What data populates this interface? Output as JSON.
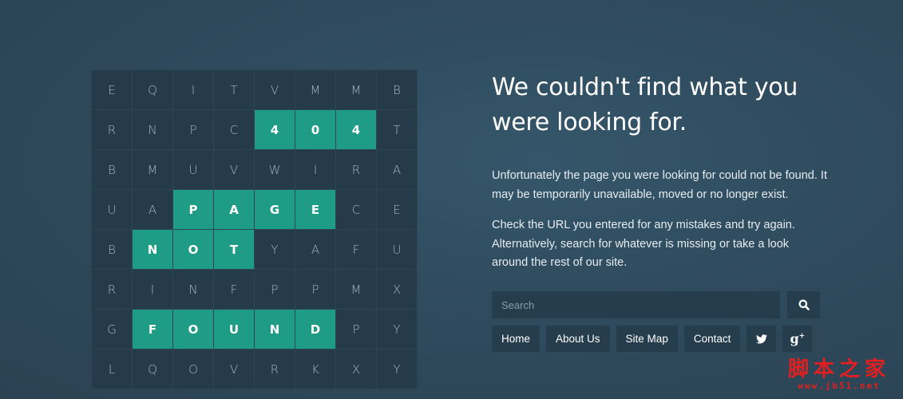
{
  "letter_grid": {
    "rows": [
      [
        "E",
        "Q",
        "I",
        "T",
        "V",
        "M",
        "M",
        "B"
      ],
      [
        "R",
        "N",
        "P",
        "C",
        "4",
        "0",
        "4",
        "T"
      ],
      [
        "B",
        "M",
        "U",
        "V",
        "W",
        "I",
        "R",
        "A"
      ],
      [
        "U",
        "A",
        "P",
        "A",
        "G",
        "E",
        "C",
        "E"
      ],
      [
        "B",
        "N",
        "O",
        "T",
        "Y",
        "A",
        "F",
        "U"
      ],
      [
        "R",
        "I",
        "N",
        "F",
        "P",
        "P",
        "M",
        "X"
      ],
      [
        "G",
        "F",
        "O",
        "U",
        "N",
        "D",
        "P",
        "Y"
      ],
      [
        "L",
        "Q",
        "O",
        "V",
        "R",
        "K",
        "X",
        "Y"
      ]
    ],
    "highlighted": [
      [
        1,
        4
      ],
      [
        1,
        5
      ],
      [
        1,
        6
      ],
      [
        3,
        2
      ],
      [
        3,
        3
      ],
      [
        3,
        4
      ],
      [
        3,
        5
      ],
      [
        4,
        1
      ],
      [
        4,
        2
      ],
      [
        4,
        3
      ],
      [
        6,
        1
      ],
      [
        6,
        2
      ],
      [
        6,
        3
      ],
      [
        6,
        4
      ],
      [
        6,
        5
      ]
    ],
    "highlight_color": "#1f9c85",
    "cell_color": "#253b4a"
  },
  "heading": {
    "line1": "We couldn't find what you",
    "line2": "were looking for."
  },
  "paragraphs": {
    "p1": "Unfortunately the page you were looking for could not be found. It may be temporarily unavailable, moved or no longer exist.",
    "p2": "Check the URL you entered for any mistakes and try again. Alternatively, search for whatever is missing or take a look around the rest of our site."
  },
  "search": {
    "placeholder": "Search",
    "value": "",
    "button_icon": "search-icon"
  },
  "nav": {
    "home": "Home",
    "about": "About Us",
    "sitemap": "Site Map",
    "contact": "Contact",
    "twitter_icon": "twitter-icon",
    "gplus_label": "g+"
  },
  "watermark": {
    "chinese": "脚本之家",
    "url": "www.jb51.net"
  }
}
